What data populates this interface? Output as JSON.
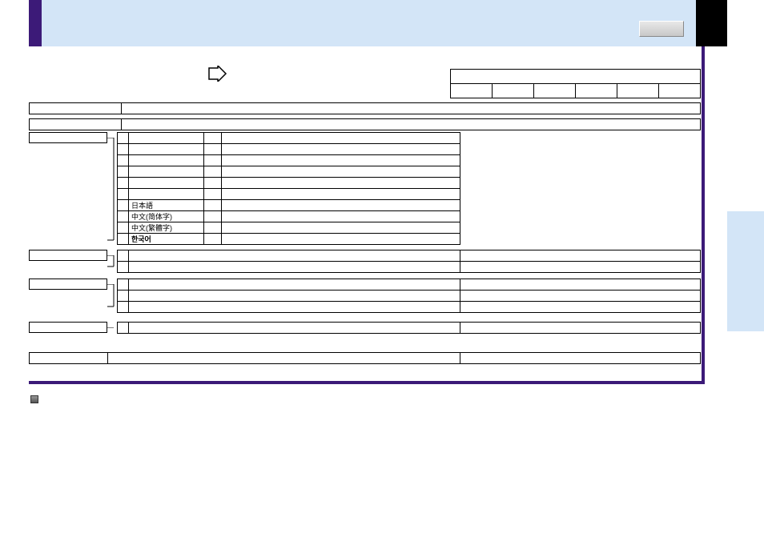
{
  "header": {
    "title": ""
  },
  "navTabs": [
    "",
    "",
    "",
    "",
    "",
    ""
  ],
  "row1": {
    "label": "",
    "content": ""
  },
  "row2": {
    "label": "",
    "content": ""
  },
  "sideLabel1": "",
  "langRows": [
    {
      "code": "",
      "lang": "",
      "channel": "",
      "desc": ""
    },
    {
      "code": "",
      "lang": "",
      "channel": "",
      "desc": ""
    },
    {
      "code": "",
      "lang": "",
      "channel": "",
      "desc": ""
    },
    {
      "code": "",
      "lang": "",
      "channel": "",
      "desc": ""
    },
    {
      "code": "",
      "lang": "",
      "channel": "",
      "desc": ""
    },
    {
      "code": "",
      "lang": "",
      "channel": "",
      "desc": ""
    },
    {
      "code": "",
      "lang": "日本語",
      "channel": "",
      "desc": ""
    },
    {
      "code": "",
      "lang": "中文(简体字)",
      "channel": "",
      "desc": ""
    },
    {
      "code": "",
      "lang": "中文(繁體字)",
      "channel": "",
      "desc": ""
    },
    {
      "code": "",
      "lang": "한국어",
      "channel": "",
      "desc": ""
    }
  ],
  "sideLabel2": "",
  "section2Rows": [
    {
      "code": "",
      "desc": "",
      "ref": ""
    },
    {
      "code": "",
      "desc": "",
      "ref": ""
    }
  ],
  "sideLabel3": "",
  "section3Rows": [
    {
      "code": "",
      "desc": "",
      "ref": ""
    },
    {
      "code": "",
      "desc": "",
      "ref": ""
    },
    {
      "code": "",
      "desc": "",
      "ref": ""
    }
  ],
  "sideLabel4": "",
  "section4Rows": [
    {
      "code": "",
      "desc": "",
      "ref": ""
    }
  ],
  "sideLabel5": "",
  "row5": {
    "desc": "",
    "ref": ""
  }
}
